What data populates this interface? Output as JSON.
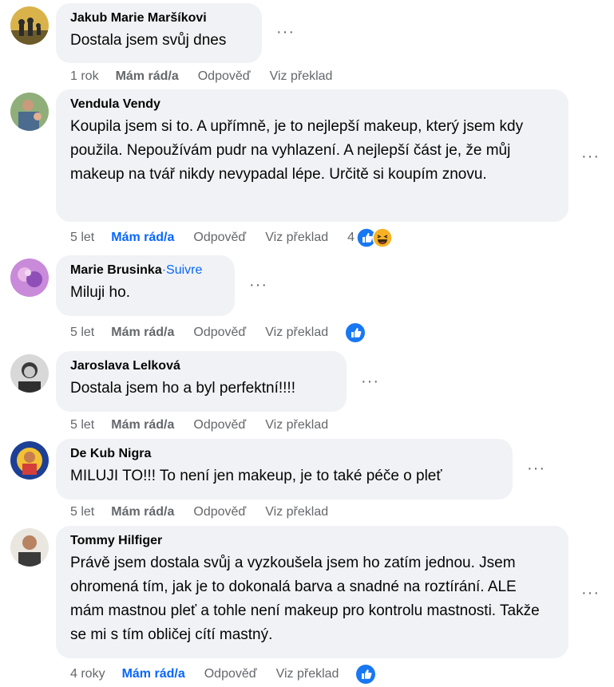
{
  "comments": [
    {
      "author": "Jakub Marie Maršíkovi",
      "follow": "",
      "text": "Dostala jsem svůj dnes",
      "time": "1 rok",
      "like_label": "Mám rád/a",
      "reply_label": "Odpověď",
      "translate_label": "Viz překlad",
      "reaction_count": ""
    },
    {
      "author": "Vendula Vendy",
      "follow": "",
      "text": "Koupila jsem si to. A upřímně, je to nejlepší makeup, který jsem kdy použila. Nepoužívám pudr na vyhlazení. A nejlepší část je, že můj makeup na tvář nikdy nevypadal lépe. Určitě si koupím znovu.",
      "time": "5 let",
      "like_label": "Mám rád/a",
      "reply_label": "Odpověď",
      "translate_label": "Viz překlad",
      "reaction_count": "4"
    },
    {
      "author": "Marie Brusinka",
      "follow": "·Suivre",
      "text": "Miluji ho.",
      "time": "5 let",
      "like_label": "Mám rád/a",
      "reply_label": "Odpověď",
      "translate_label": "Viz překlad",
      "reaction_count": ""
    },
    {
      "author": "Jaroslava Lelková",
      "follow": "",
      "text": "Dostala jsem ho a byl perfektní!!!!",
      "time": "5 let",
      "like_label": "Mám rád/a",
      "reply_label": "Odpověď",
      "translate_label": "Viz překlad",
      "reaction_count": ""
    },
    {
      "author": "De Kub Nigra",
      "follow": "",
      "text": "MILUJI TO!!! To není jen makeup, je to také péče o pleť",
      "time": "5 let",
      "like_label": "Mám rád/a",
      "reply_label": "Odpověď",
      "translate_label": "Viz překlad",
      "reaction_count": ""
    },
    {
      "author": "Tommy Hilfiger",
      "follow": "",
      "text": "Právě jsem dostala svůj a vyzkoušela jsem ho zatím jednou. Jsem ohromená tím, jak je to dokonalá barva a snadné na roztírání. ALE mám mastnou pleť a tohle není makeup pro kontrolu mastnosti. Takže se mi s tím obličej cítí mastný.",
      "time": "4 roky",
      "like_label": "Mám rád/a",
      "reply_label": "Odpověď",
      "translate_label": "Viz překlad",
      "reaction_count": ""
    }
  ],
  "icons": {
    "more": "more-options-icon",
    "like": "like-reaction-icon",
    "haha": "haha-reaction-icon"
  },
  "colors": {
    "bubble": "#f0f2f5",
    "link_blue": "#0866ff",
    "meta_gray": "#65676b"
  }
}
